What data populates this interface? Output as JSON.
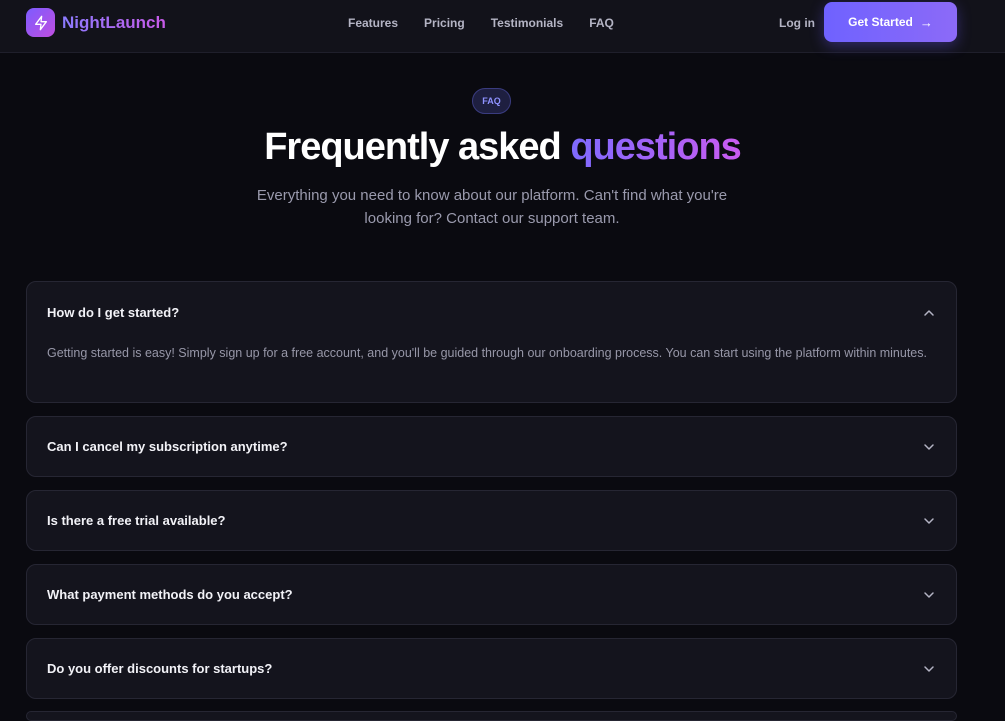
{
  "brand": {
    "name": "NightLaunch",
    "logo_icon": "bolt-icon"
  },
  "nav": {
    "items": [
      {
        "label": "Features"
      },
      {
        "label": "Pricing"
      },
      {
        "label": "Testimonials"
      },
      {
        "label": "FAQ"
      }
    ],
    "login_label": "Log in",
    "cta_label": "Get Started",
    "cta_icon": "arrow-right-icon"
  },
  "hero": {
    "badge": "FAQ",
    "title_plain": "Frequently asked ",
    "title_highlight": "questions",
    "subtitle": "Everything you need to know about our platform. Can't find what you're looking for? Contact our support team."
  },
  "faq": [
    {
      "question": "How do I get started?",
      "answer": "Getting started is easy! Simply sign up for a free account, and you'll be guided through our onboarding process. You can start using the platform within minutes.",
      "expanded": true
    },
    {
      "question": "Can I cancel my subscription anytime?",
      "expanded": false
    },
    {
      "question": "Is there a free trial available?",
      "expanded": false
    },
    {
      "question": "What payment methods do you accept?",
      "expanded": false
    },
    {
      "question": "Do you offer discounts for startups?",
      "expanded": false
    }
  ],
  "colors": {
    "background": "#0a0a10",
    "accent_start": "#6f62ff",
    "accent_end": "#c95bf0"
  }
}
